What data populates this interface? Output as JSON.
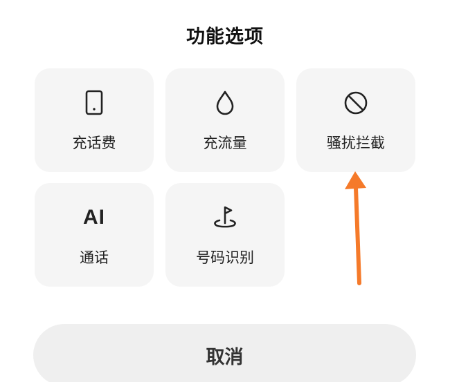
{
  "sheet": {
    "title": "功能选项",
    "options": [
      {
        "label": "充话费",
        "icon": "phone-icon"
      },
      {
        "label": "充流量",
        "icon": "droplet-icon"
      },
      {
        "label": "骚扰拦截",
        "icon": "block-icon"
      },
      {
        "label": "通话",
        "icon": "ai-icon",
        "icon_text": "AI"
      },
      {
        "label": "号码识别",
        "icon": "location-flag-icon"
      }
    ],
    "cancel_label": "取消"
  },
  "annotation": {
    "color": "#f57a2a",
    "icon": "arrow-up-icon"
  },
  "colors": {
    "tile_bg": "#f5f5f5",
    "cancel_bg": "#efefef",
    "text": "#222222"
  }
}
